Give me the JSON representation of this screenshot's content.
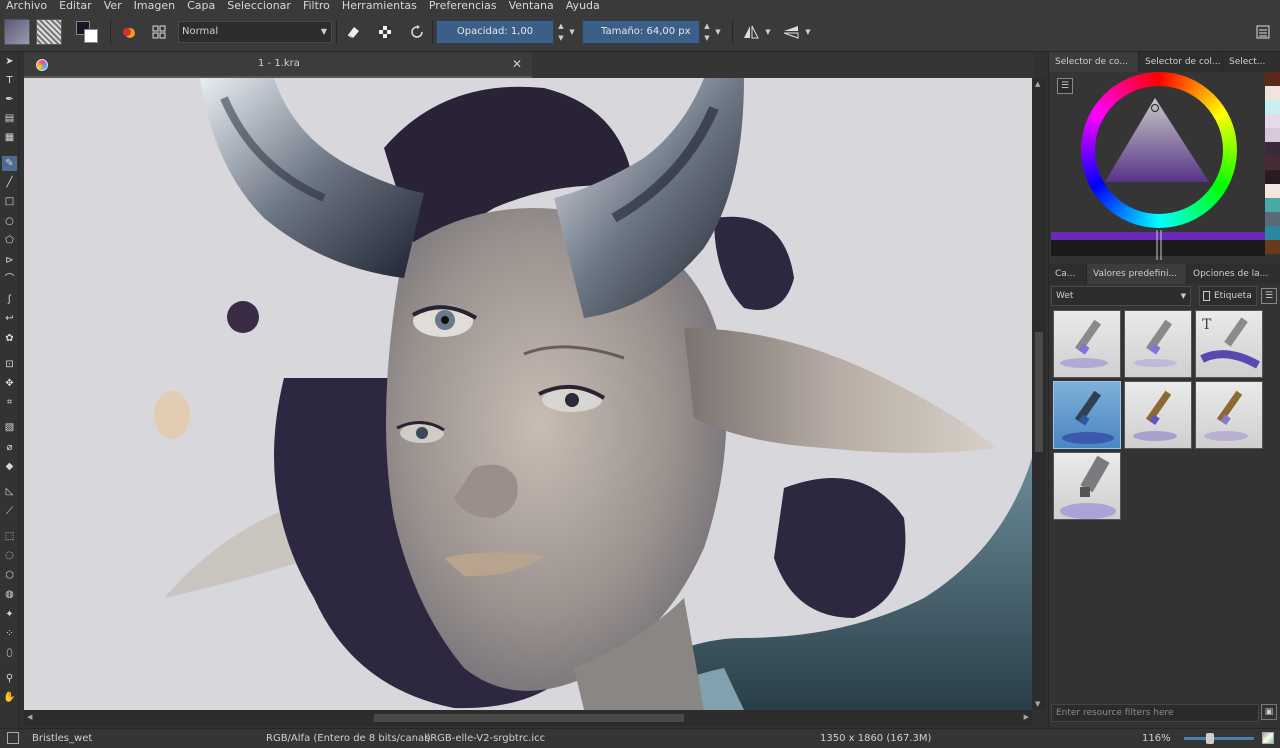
{
  "menu": [
    "Archivo",
    "Editar",
    "Ver",
    "Imagen",
    "Capa",
    "Seleccionar",
    "Filtro",
    "Herramientas",
    "Preferencias",
    "Ventana",
    "Ayuda"
  ],
  "toolbar": {
    "blend_mode": "Normal",
    "opacity_label": "Opacidad:",
    "opacity_value": "1,00",
    "size_label": "Tamaño:",
    "size_value": "64,00 px"
  },
  "document": {
    "tab_title": "1 - 1.kra"
  },
  "right_panel": {
    "top_tabs": [
      "Selector de co...",
      "Selector de col...",
      "Select..."
    ],
    "preset_tabs": [
      "Ca...",
      "Valores predefini...",
      "Opciones de la..."
    ],
    "preset_filter": "Wet",
    "tag_label": "Etiqueta",
    "filter_placeholder": "Enter resource filters here",
    "palette": [
      "#5a2a1a",
      "#f0e4dc",
      "#c8eef0",
      "#e8d8ec",
      "#d8c8dc",
      "#3a2a3a",
      "#4a2a36",
      "#2a1a22",
      "#f6e6e0",
      "#4aa8a8",
      "#5a6a78",
      "#2a88a0",
      "#6a3a1a"
    ]
  },
  "status": {
    "brush": "Bristles_wet",
    "color_model": "RGB/Alfa (Entero de 8 bits/canal)",
    "profile": "sRGB-elle-V2-srgbtrc.icc",
    "dimensions": "1350 x 1860 (167.3M)",
    "zoom": "116%"
  },
  "colors": {
    "accent": "#3b5f86",
    "background": "#313131",
    "canvas_bg": "#d8d8dc"
  },
  "icons": {
    "tools": [
      "select-shapes-icon",
      "text-icon",
      "calligraphy-icon",
      "edit-shapes-icon",
      "pattern-icon",
      "freehand-brush-icon",
      "line-icon",
      "rectangle-icon",
      "ellipse-icon",
      "polygon-icon",
      "polyline-icon",
      "bezier-icon",
      "freehand-path-icon",
      "dynamic-brush-icon",
      "multibrush-icon",
      "transform-icon",
      "move-icon",
      "crop-icon",
      "gradient-icon",
      "color-picker-icon",
      "fill-icon",
      "assistant-icon",
      "measure-icon",
      "rect-select-icon",
      "ellipse-select-icon",
      "polygon-select-icon",
      "freehand-select-icon",
      "contiguous-select-icon",
      "similar-select-icon",
      "bezier-select-icon",
      "magnetic-select-icon",
      "zoom-icon",
      "pan-icon"
    ]
  }
}
